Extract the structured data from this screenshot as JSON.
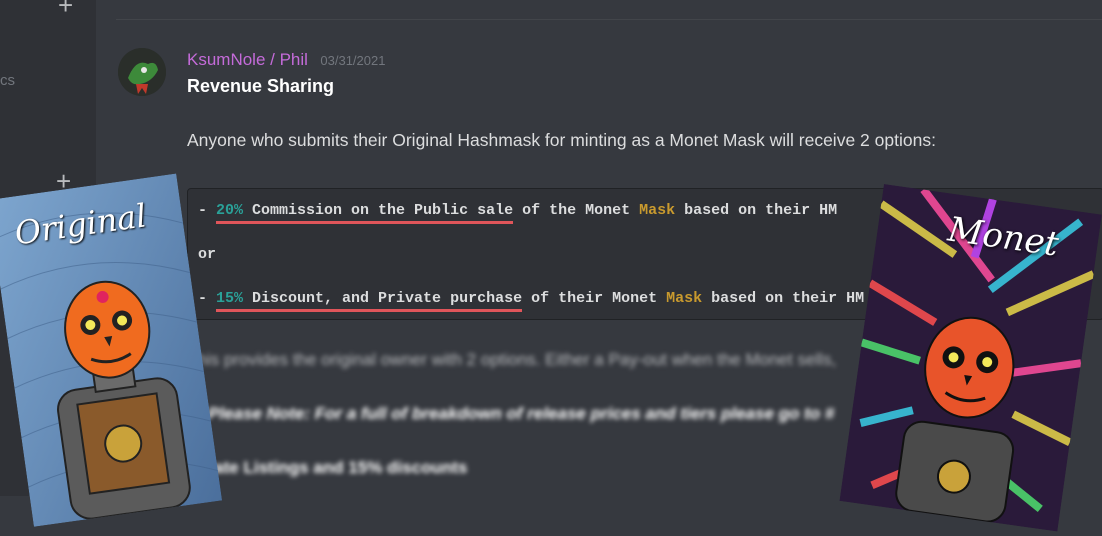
{
  "server_rail": {
    "partial_text": "cs"
  },
  "message": {
    "author": "KsumNole / Phil",
    "timestamp": "03/31/2021",
    "title": "Revenue Sharing",
    "intro": "Anyone who submits their Original Hashmask for minting as a Monet Mask will receive 2 options:",
    "code_block": {
      "line1": {
        "dash": "- ",
        "percent": "20%",
        "underlined": " Commission on the Public sale",
        "mid": " of the Monet ",
        "highlight": "Mask",
        "tail": " based on their HM"
      },
      "line2": {
        "text": "or"
      },
      "line3": {
        "dash": "- ",
        "percent": "15%",
        "underlined": " Discount, and Private purchase",
        "mid": " of their Monet ",
        "highlight": "Mask",
        "tail": " based on their HM"
      }
    },
    "blurred_line1": "This provides the original owner with 2 options. Either a Pay-out when the Monet sells,",
    "blurred_line2": "Please Note: For a full of breakdown of release prices and tiers please go to #",
    "blurred_line3": "ivate Listings and 15% discounts"
  },
  "overlay_cards": {
    "left_label": "Original",
    "right_label": "Monet"
  },
  "colors": {
    "background": "#36393f",
    "rail": "#2f3136",
    "author": "#c46bd9",
    "teal": "#2aa198",
    "gold": "#c99a2e",
    "underline": "#e0555a"
  }
}
